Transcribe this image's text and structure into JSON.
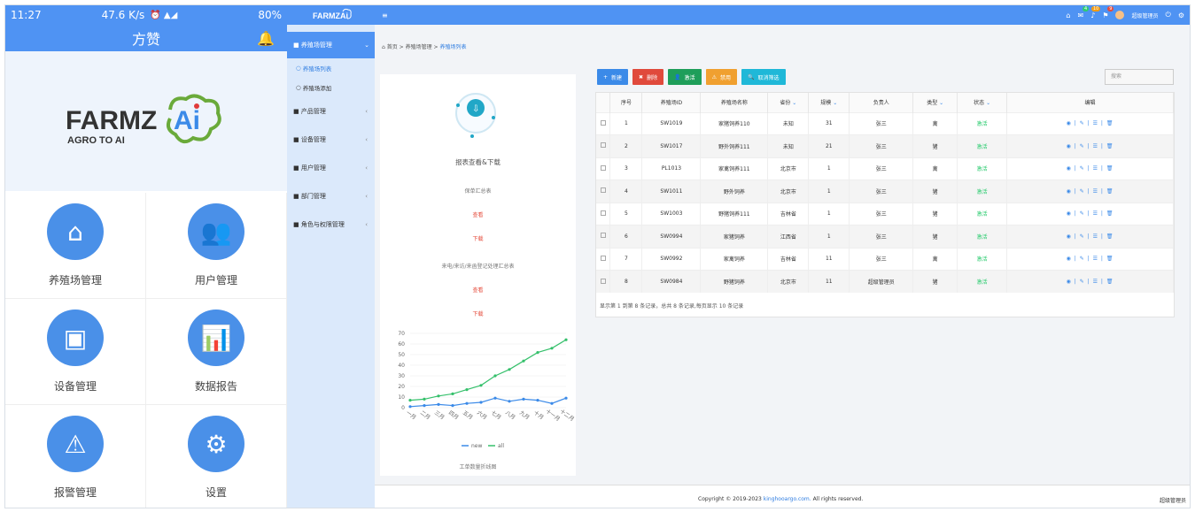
{
  "phone": {
    "time": "11:27",
    "net": "47.6 K/s",
    "battery": "80%",
    "title": "方赞",
    "logo_text": "FARMZAi",
    "logo_sub": "AGRO TO AI",
    "tiles": [
      {
        "label": "养殖场管理",
        "icon": "farm-icon"
      },
      {
        "label": "用户管理",
        "icon": "users-icon"
      },
      {
        "label": "设备管理",
        "icon": "device-icon"
      },
      {
        "label": "数据报告",
        "icon": "chart-icon"
      },
      {
        "label": "报警管理",
        "icon": "alarm-icon"
      },
      {
        "label": "设置",
        "icon": "gear-icon"
      }
    ]
  },
  "sidebar": {
    "logo": "FARMZAi",
    "active": "养殖场管理",
    "subs": [
      "养殖场列表",
      "养殖场添加"
    ],
    "items": [
      "产品管理",
      "设备管理",
      "用户管理",
      "部门管理",
      "角色与权限管理"
    ]
  },
  "topbar": {
    "menu": "≡",
    "badges": [
      "4",
      "10",
      "9"
    ],
    "user": "超级管理员"
  },
  "crumbs": {
    "home": "首页",
    "mid": "养殖场管理",
    "cur": "养殖场列表"
  },
  "report": {
    "title": "报表查看&下载",
    "r1": "保单汇总表",
    "view": "查看",
    "dl": "下载",
    "r2": "来电/来访/来函登记处理汇总表",
    "chart_title": "工单数量折线图"
  },
  "chart_data": {
    "type": "line",
    "x": [
      "一月",
      "二月",
      "三月",
      "四月",
      "五月",
      "六月",
      "七月",
      "八月",
      "九月",
      "十月",
      "十一月",
      "十二月"
    ],
    "yticks": [
      0,
      10,
      20,
      30,
      40,
      50,
      60,
      70
    ],
    "ylim": [
      0,
      70
    ],
    "series": [
      {
        "name": "new",
        "color": "#3b8ae8",
        "values": [
          1,
          2,
          3,
          2,
          4,
          5,
          9,
          6,
          8,
          7,
          4,
          9
        ]
      },
      {
        "name": "all",
        "color": "#35c06b",
        "values": [
          7,
          8,
          11,
          13,
          17,
          21,
          30,
          36,
          44,
          52,
          56,
          64
        ]
      }
    ]
  },
  "toolbar": {
    "add": "新建",
    "del": "删除",
    "enable": "激活",
    "disable": "禁用",
    "clear": "取消筛选"
  },
  "search_ph": "搜索",
  "table": {
    "headers": [
      "",
      "序号",
      "养殖场ID",
      "养殖场名称",
      "省份",
      "规模",
      "负责人",
      "类型",
      "状态",
      "编辑"
    ],
    "rows": [
      [
        "1",
        "SW1019",
        "家猪饲养110",
        "未知",
        "31",
        "张三",
        "禽",
        "激活"
      ],
      [
        "2",
        "SW1017",
        "野外饲养111",
        "未知",
        "21",
        "张三",
        "猪",
        "激活"
      ],
      [
        "3",
        "PL1013",
        "家禽饲养111",
        "北京市",
        "1",
        "张三",
        "禽",
        "激活"
      ],
      [
        "4",
        "SW1011",
        "野外饲养",
        "北京市",
        "1",
        "张三",
        "猪",
        "激活"
      ],
      [
        "5",
        "SW1003",
        "野猪饲养111",
        "吉林省",
        "1",
        "张三",
        "猪",
        "激活"
      ],
      [
        "6",
        "SW0994",
        "家猪饲养",
        "江西省",
        "1",
        "张三",
        "猪",
        "激活"
      ],
      [
        "7",
        "SW0992",
        "家禽饲养",
        "吉林省",
        "11",
        "张三",
        "禽",
        "激活"
      ],
      [
        "8",
        "SW0984",
        "野猪饲养",
        "北京市",
        "11",
        "超级管理员",
        "猪",
        "激活"
      ]
    ],
    "info": "显示第 1 到第 8 条记录，总共 8 条记录,每页显示 10 条记录"
  },
  "footer": {
    "copy": "Copyright © 2019-2023 ",
    "site": "kinghooargo.com.",
    "rights": " All rights reserved.",
    "right": "超级管理员"
  }
}
